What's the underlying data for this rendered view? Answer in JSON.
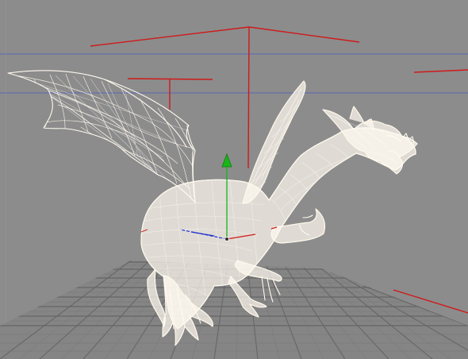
{
  "viewport": {
    "background": "#8c8c8c",
    "grid_color": "#666666",
    "blue_guide_color": "#5d66b5",
    "red_guide_color": "#d01919",
    "model_color": "#fff8eb",
    "gizmo_y_color": "#19b519",
    "gizmo_x_color": "#d01919",
    "gizmo_z_color": "#2233dd"
  },
  "objects": {
    "model": "dragon-wireframe",
    "gizmo": "transform-gizmo",
    "floor": "perspective-grid"
  }
}
